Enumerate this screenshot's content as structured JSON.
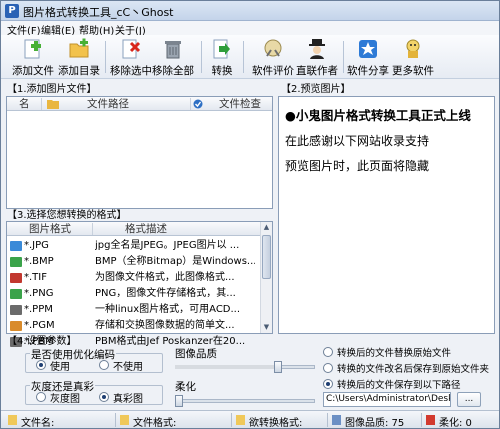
{
  "window": {
    "title": "图片格式转换工具_cC丶Ghost",
    "app_icon": "P"
  },
  "menu": [
    "文件(F)",
    "编辑(E)",
    "帮助(H)",
    "关于(J)"
  ],
  "toolbar": {
    "add_file": "添加文件",
    "add_dir": "添加目录",
    "remove_selected": "移除选中",
    "remove_all": "移除全部",
    "convert": "转换",
    "rate": "软件评价",
    "contact": "直联作者",
    "share": "软件分享",
    "more": "更多软件"
  },
  "add_panel": {
    "title": "【1.添加图片文件】",
    "columns": [
      "名",
      "文件路径",
      "文件检查"
    ]
  },
  "preview_panel": {
    "title": "【2.预览图片】",
    "headline": "●小鬼图片格式转换工具正式上线",
    "line1": "在此感谢以下网站收录支持",
    "line2": "预览图片时，此页面将隐藏"
  },
  "format_panel": {
    "title": "【3.选择您想转换的格式】",
    "columns": [
      "图片格式",
      "格式描述"
    ],
    "rows": [
      {
        "name": "*.JPG",
        "desc": "jpg全名是JPEG。JPEG图片以 ..."
      },
      {
        "name": "*.BMP",
        "desc": "BMP（全称Bitmap）是Windows..."
      },
      {
        "name": "*.TIF",
        "desc": "为图像文件格式，此图像格式..."
      },
      {
        "name": "*.PNG",
        "desc": "PNG，图像文件存储格式，其..."
      },
      {
        "name": "*.PPM",
        "desc": "一种linux图片格式，可用ACD..."
      },
      {
        "name": "*.PGM",
        "desc": "存储和交换图像数据的简单文..."
      },
      {
        "name": "*.PBM",
        "desc": "PBM格式由Jef Poskanzer在20..."
      }
    ],
    "icon_colors": [
      "#3a8ad8",
      "#3aa34a",
      "#c2382f",
      "#3aa34a",
      "#6b6b6b",
      "#d98b2b",
      "#6b6b6b"
    ]
  },
  "settings": {
    "title": "【4.设置参数】",
    "optimize_group": "是否使用优化编码",
    "use": "使用",
    "no_use": "不使用",
    "color_group": "灰度还是真彩",
    "gray": "灰度图",
    "truecolor": "真彩图",
    "quality_label": "图像品质",
    "quality_value": 75,
    "blur_label": "柔化",
    "blur_value": 0,
    "opt_replace": "转换后的文件替换原始文件",
    "opt_rename": "转换的文件改名后保存到原始文件夹",
    "opt_saveto": "转换后的文件保存到以下路径",
    "path": "C:\\Users\\Administrator\\Desk",
    "browse": "..."
  },
  "status": {
    "file_name": "文件名:",
    "file_format": "文件格式:",
    "target_format": "欲转换格式:",
    "quality": "图像品质: 75",
    "blur": "柔化: 0"
  }
}
